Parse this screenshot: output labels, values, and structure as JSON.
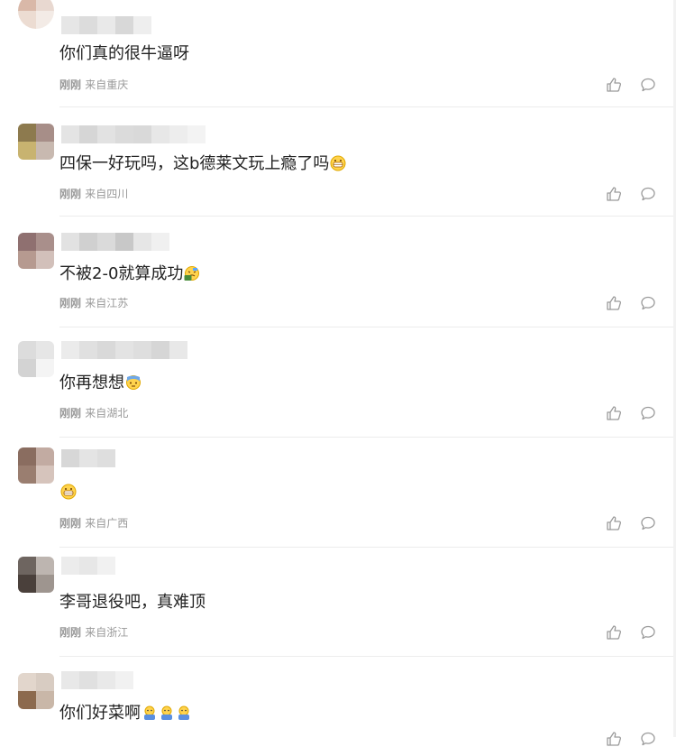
{
  "comments": [
    {
      "text": "你们真的很牛逼呀",
      "time": "刚刚",
      "location": "来自重庆",
      "emojis": []
    },
    {
      "text": "四保一好玩吗，这b德莱文玩上瘾了吗",
      "time": "刚刚",
      "location": "来自四川",
      "emojis": [
        "grin-face-emoji"
      ]
    },
    {
      "text": "不被2-0就算成功",
      "time": "刚刚",
      "location": "来自江苏",
      "emojis": [
        "tired-face-emoji"
      ]
    },
    {
      "text": "你再想想",
      "time": "刚刚",
      "location": "来自湖北",
      "emojis": [
        "cold-sweat-face-emoji"
      ]
    },
    {
      "text": "",
      "time": "刚刚",
      "location": "来自广西",
      "emojis": [
        "grin-face-emoji"
      ]
    },
    {
      "text": "李哥退役吧，真难顶",
      "time": "刚刚",
      "location": "来自浙江",
      "emojis": []
    },
    {
      "text": "你们好菜啊",
      "time": "",
      "location": "",
      "emojis": [
        "doge-emoji",
        "doge-emoji",
        "doge-emoji"
      ]
    }
  ],
  "icons": {
    "like": "thumbs-up-icon",
    "reply": "comment-bubble-icon"
  },
  "colors": {
    "text": "#222222",
    "meta": "#999999",
    "divider": "#ececec"
  }
}
